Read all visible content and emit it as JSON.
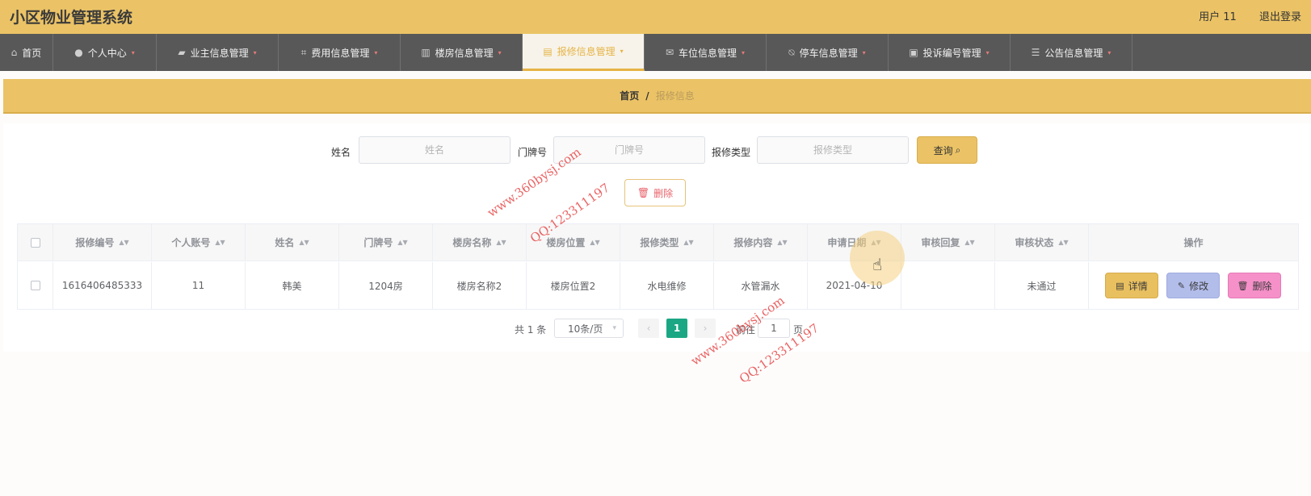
{
  "app": {
    "title": "小区物业管理系统",
    "user": "用户 11",
    "logout": "退出登录"
  },
  "nav": {
    "items": [
      {
        "label": "首页",
        "icon": "home-icon"
      },
      {
        "label": "个人中心",
        "icon": "user-icon"
      },
      {
        "label": "业主信息管理",
        "icon": "wallet-icon"
      },
      {
        "label": "费用信息管理",
        "icon": "crop-icon"
      },
      {
        "label": "楼房信息管理",
        "icon": "building-icon"
      },
      {
        "label": "报修信息管理",
        "icon": "chat-icon",
        "active": true
      },
      {
        "label": "车位信息管理",
        "icon": "mail-icon"
      },
      {
        "label": "停车信息管理",
        "icon": "bell-off-icon"
      },
      {
        "label": "投诉编号管理",
        "icon": "briefcase-icon"
      },
      {
        "label": "公告信息管理",
        "icon": "sliders-icon"
      }
    ]
  },
  "breadcrumb": {
    "home": "首页",
    "sep": "/",
    "current": "报修信息"
  },
  "search": {
    "name_label": "姓名",
    "name_placeholder": "姓名",
    "door_label": "门牌号",
    "door_placeholder": "门牌号",
    "type_label": "报修类型",
    "type_placeholder": "报修类型",
    "query_label": "查询 ",
    "delete_label": "删除"
  },
  "table": {
    "headers": [
      "报修编号",
      "个人账号",
      "姓名",
      "门牌号",
      "楼房名称",
      "楼房位置",
      "报修类型",
      "报修内容",
      "申请日期",
      "审核回复",
      "审核状态",
      "操作"
    ],
    "rows": [
      {
        "cells": [
          "1616406485333",
          "11",
          "韩美",
          "1204房",
          "楼房名称2",
          "楼房位置2",
          "水电维修",
          "水管漏水",
          "2021-04-10",
          "",
          "未通过"
        ],
        "detail": "详情",
        "edit": "修改",
        "delete": "删除"
      }
    ]
  },
  "pagination": {
    "total": "共 1 条",
    "page_size": "10条/页",
    "current_page": "1",
    "goto_prefix": "前往",
    "goto_value": "1",
    "goto_suffix": "页"
  },
  "watermarks": [
    "www.360bysj.com",
    "QQ:123311197"
  ],
  "colors": {
    "header": "#ebc366",
    "nav": "#585858",
    "accent": "#e6b446",
    "page_active": "#1ba784"
  }
}
